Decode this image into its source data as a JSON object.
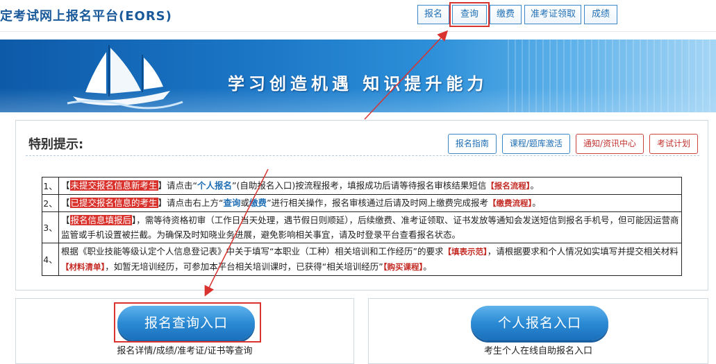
{
  "header": {
    "title": "定考试网上报名平台(EORS)",
    "nav": [
      {
        "label": "报名"
      },
      {
        "label": "查询"
      },
      {
        "label": "缴费"
      },
      {
        "label": "准考证领取"
      },
      {
        "label": "成绩"
      }
    ]
  },
  "banner": {
    "slogan": "学习创造机遇  知识提升能力"
  },
  "notice": {
    "title": "特别提示:",
    "tabs": [
      {
        "label": "报名指南"
      },
      {
        "label": "课程/题库激活"
      },
      {
        "label": "通知/资讯中心"
      },
      {
        "label": "考试计划"
      }
    ],
    "rows": [
      {
        "idx": "1、",
        "pre": "【",
        "highlight": "未提交报名信息新考生",
        "mid": "】请点击“",
        "link1": "个人报名",
        "post": "”(自助报名入口)按流程报考，填报成功后请等待报名审核结果短信",
        "tag": "【报名流程】",
        "end": "。"
      },
      {
        "idx": "2、",
        "pre": "【",
        "highlight": "已提交报名信息的考生",
        "mid": "】请点击右上方“",
        "link1": "查询",
        "or": "或",
        "link2": "缴费",
        "post": "”进行相关操作，报名审核通过后请及时网上缴费完成报考",
        "tag": "【缴费流程】",
        "end": "。"
      },
      {
        "idx": "3、",
        "pre": "【",
        "highlight": "报名信息填报后",
        "post": "】，需等待资格初审（工作日当天处理，遇节假日则顺延），后续缴费、准考证领取、证书发放等通知会发送短信到报名手机号，但可能因运营商监管或手机设置被拦截。为确保及时知晓业务进展，避免影响相关事宜，请及时登录平台查看报名状态。"
      },
      {
        "idx": "4、",
        "text1": "根据《职业技能等级认定个人信息登记表》中关于填写“本职业（工种）相关培训和工作经历”的要求",
        "tag1": "【填表示范】",
        "text2": "，请根据要求和个人情况如实填写并提交相关材料",
        "tag2": "【材料清单】",
        "text3": "，如暂无培训经历，可参加本平台相关培训课时，已获得“相关培训经历”",
        "tag3": "【购买课程】",
        "end": "。"
      }
    ]
  },
  "entries": {
    "query": {
      "label": "报名查询入口",
      "caption": "报名详情/成绩/准考证/证书等查询"
    },
    "register": {
      "label": "个人报名入口",
      "caption": "考生个人在线自助报名入口"
    }
  },
  "colors": {
    "accent": "#1f6fb5",
    "highlight": "#d9312b"
  }
}
